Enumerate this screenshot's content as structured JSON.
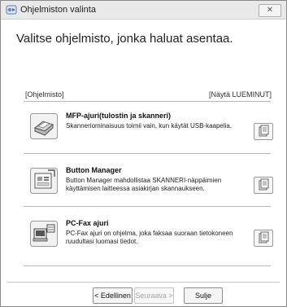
{
  "window": {
    "title": "Ohjelmiston valinta",
    "close_label": "✕"
  },
  "heading": "Valitse ohjelmisto, jonka haluat asentaa.",
  "section_label": "[Ohjelmisto]",
  "show_all_label": "[Näytä LUEMINUT]",
  "items": [
    {
      "title": "MFP-ajuri(tulostin ja skanneri)",
      "description": "Skanneriominaisuus toimii vain, kun käytät USB-kaapelia.",
      "icon": "printer-scanner-icon"
    },
    {
      "title": "Button Manager",
      "description": "Button Manager mahdollistaa SKANNERI-näppäimien käyttämisen laitteessa asiakirjan skannaukseen.",
      "icon": "button-manager-icon"
    },
    {
      "title": "PC-Fax ajuri",
      "description": "PC-Fax ajuri on ohjelma, joka faksaa suoraan tietokoneen ruudultasi luomasi tiedot.",
      "icon": "pc-fax-icon"
    }
  ],
  "buttons": {
    "back": "< Edellinen",
    "next": "Seuraava >",
    "close": "Sulje"
  }
}
